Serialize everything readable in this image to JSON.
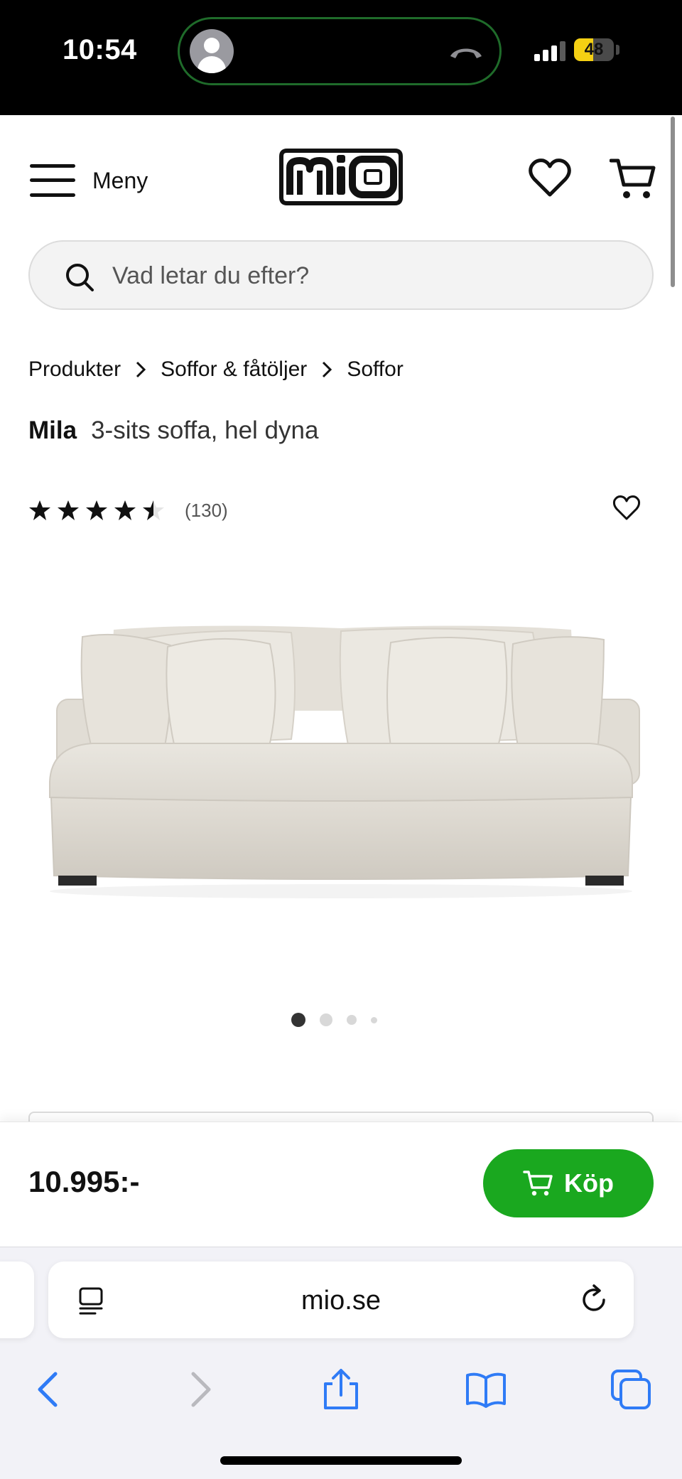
{
  "status_bar": {
    "time": "10:54",
    "battery_level": "48",
    "battery_fraction": 0.48,
    "signal_bars_active": 3,
    "signal_bars_total": 4
  },
  "header": {
    "menu_label": "Meny",
    "logo_alt": "mio"
  },
  "search": {
    "placeholder": "Vad letar du efter?"
  },
  "breadcrumb": [
    "Produkter",
    "Soffor & fåtöljer",
    "Soffor"
  ],
  "product": {
    "brand": "Mila",
    "name": "3-sits soffa, hel dyna",
    "rating": 4.5,
    "rating_max": 5,
    "review_count": "(130)",
    "image_alt": "Mila 3-sits soffa, hel dyna",
    "image_count": 4,
    "active_image": 1
  },
  "buy_bar": {
    "price": "10.995:-",
    "buy_label": "Köp"
  },
  "browser": {
    "url": "mio.se"
  },
  "colors": {
    "accent_green": "#1aa81f",
    "ios_blue": "#2f7bf6",
    "battery_yellow": "#f5d013"
  }
}
